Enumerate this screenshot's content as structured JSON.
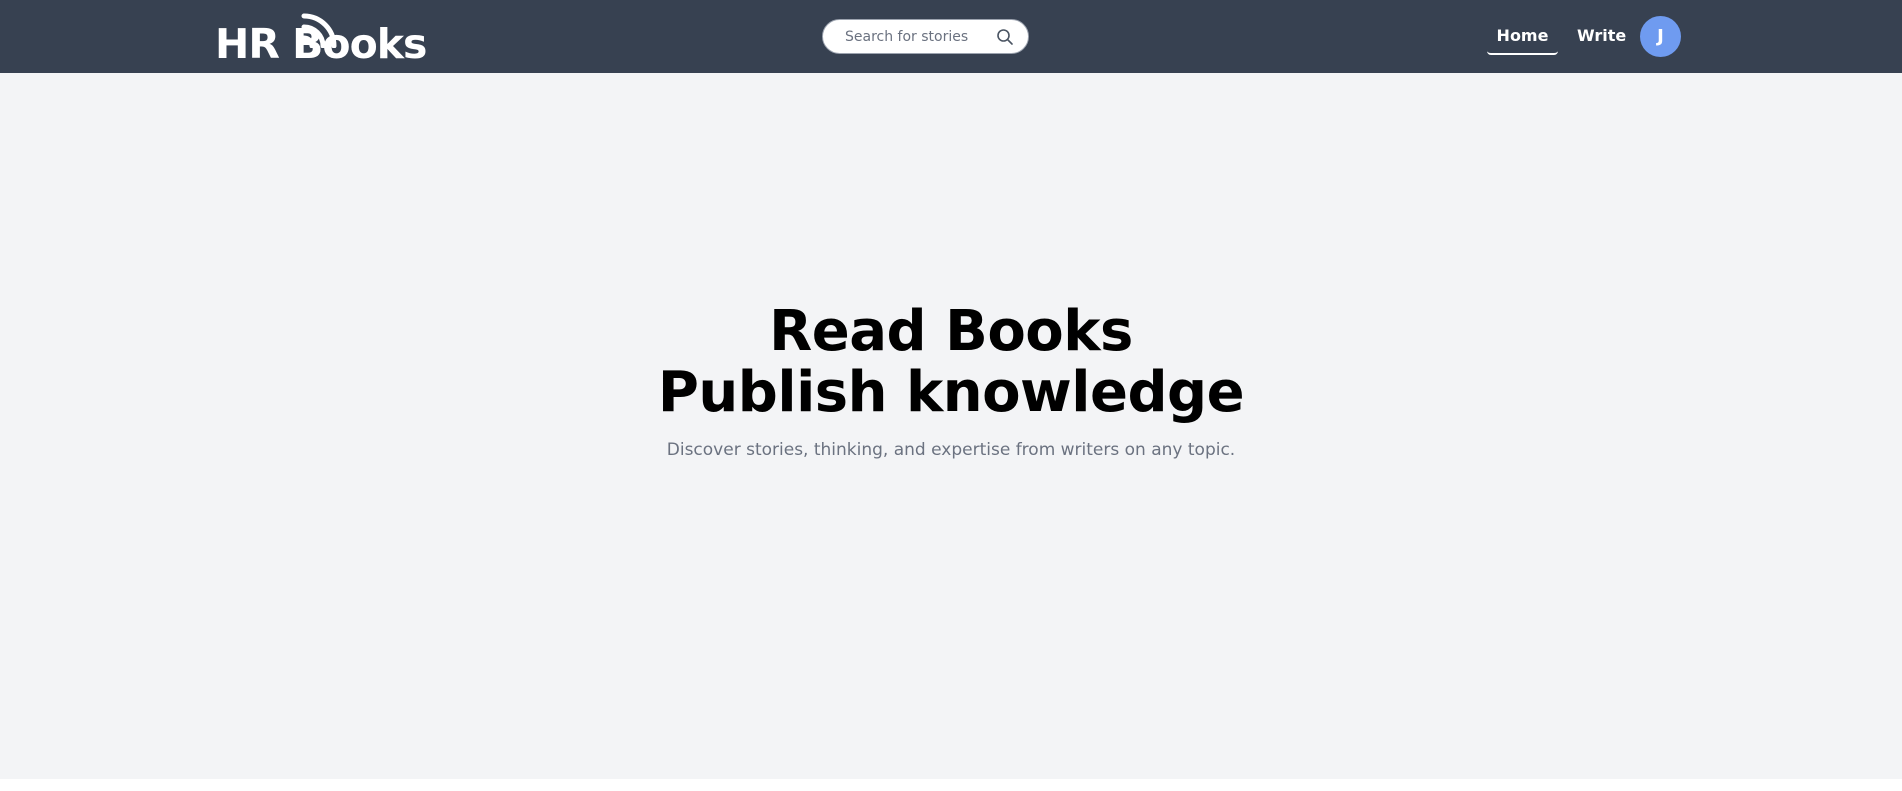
{
  "navbar": {
    "background": "#374151",
    "logo_text": "HR Books",
    "search": {
      "placeholder": "Search for stories",
      "icon": "search-icon"
    },
    "links": [
      {
        "label": "Home",
        "active": true
      },
      {
        "label": "Write",
        "active": false
      }
    ],
    "avatar": {
      "initial": "J",
      "color": "#6f9bf0"
    }
  },
  "hero": {
    "background": "#f3f4f6",
    "title_line1": "Read Books",
    "title_line2": "Publish knowledge",
    "subtitle": "Discover stories, thinking, and expertise from writers on any topic."
  }
}
